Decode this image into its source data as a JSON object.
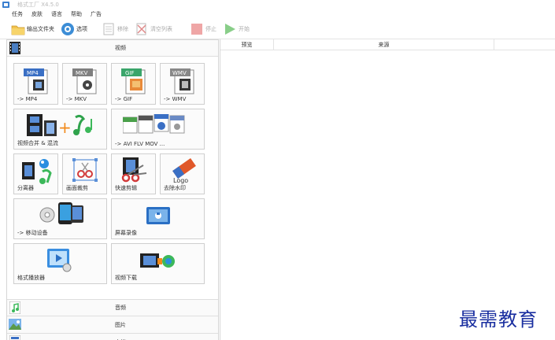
{
  "window": {
    "title": "格式工厂 X4.5.0"
  },
  "menu": [
    "任务",
    "皮肤",
    "语言",
    "帮助",
    "广告"
  ],
  "toolbar": {
    "buttons": [
      {
        "label": "输出文件夹",
        "icon": "folder-icon",
        "disabled": false
      },
      {
        "label": "选项",
        "icon": "options-icon",
        "disabled": false
      },
      {
        "label": "移除",
        "icon": "remove-icon",
        "disabled": true
      },
      {
        "label": "清空列表",
        "icon": "clear-list-icon",
        "disabled": true
      },
      {
        "label": "停止",
        "icon": "stop-icon",
        "disabled": true
      },
      {
        "label": "开始",
        "icon": "start-icon",
        "disabled": true
      }
    ]
  },
  "left": {
    "video_section": {
      "label": "视频",
      "icon": "video-icon"
    },
    "tiles": [
      {
        "label": "-> MP4",
        "icon": "mp4-icon",
        "badge": "MP4"
      },
      {
        "label": "-> MKV",
        "icon": "mkv-icon",
        "badge": "MKV"
      },
      {
        "label": "-> GIF",
        "icon": "gif-icon",
        "badge": "GIF"
      },
      {
        "label": "-> WMV",
        "icon": "wmv-icon",
        "badge": "WMV"
      },
      {
        "label": "视频合并 & 混流",
        "icon": "video-merge-icon"
      },
      {
        "label": "-> AVI FLV MOV ...",
        "icon": "multi-format-icon"
      },
      {
        "label": "分离器",
        "icon": "splitter-icon"
      },
      {
        "label": "画面裁剪",
        "icon": "crop-icon"
      },
      {
        "label": "快速剪辑",
        "icon": "quick-clip-icon"
      },
      {
        "label": "去除水印",
        "icon": "remove-watermark-icon"
      },
      {
        "label": "-> 移动设备",
        "icon": "mobile-device-icon"
      },
      {
        "label": "屏幕录像",
        "icon": "screen-record-icon"
      },
      {
        "label": "格式播放器",
        "icon": "player-icon"
      },
      {
        "label": "视频下载",
        "icon": "video-download-icon"
      }
    ],
    "bottom_sections": [
      {
        "label": "音频",
        "icon": "audio-icon"
      },
      {
        "label": "图片",
        "icon": "picture-icon"
      },
      {
        "label": "文档",
        "icon": "document-icon"
      }
    ]
  },
  "right": {
    "columns": [
      "预览",
      "来源"
    ]
  },
  "watermark": "最需教育",
  "colors": {
    "accent": "#3c8dd6",
    "watermark": "#1a2fa0",
    "stop_red": "#e56b6b",
    "start_green": "#6bc26b"
  }
}
